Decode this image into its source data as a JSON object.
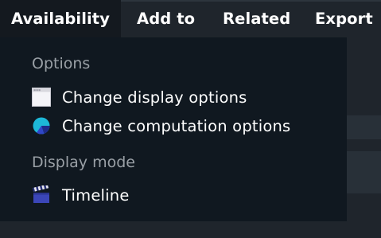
{
  "menubar": {
    "items": [
      {
        "label": "Availability",
        "active": true
      },
      {
        "label": "Add to"
      },
      {
        "label": "Related"
      },
      {
        "label": "Export"
      }
    ]
  },
  "dropdown": {
    "sections": [
      {
        "title": "Options",
        "entries": [
          {
            "label": "Change display options",
            "icon": "window-icon"
          },
          {
            "label": "Change computation options",
            "icon": "pie-chart-icon"
          }
        ]
      },
      {
        "title": "Display mode",
        "entries": [
          {
            "label": "Timeline",
            "icon": "clapperboard-icon"
          }
        ]
      }
    ]
  },
  "colors": {
    "menubar_bg": "#1f252c",
    "active_bg": "#14191f",
    "dropdown_bg": "#101820",
    "section_title": "#9aa0a6",
    "text": "#ffffff"
  }
}
